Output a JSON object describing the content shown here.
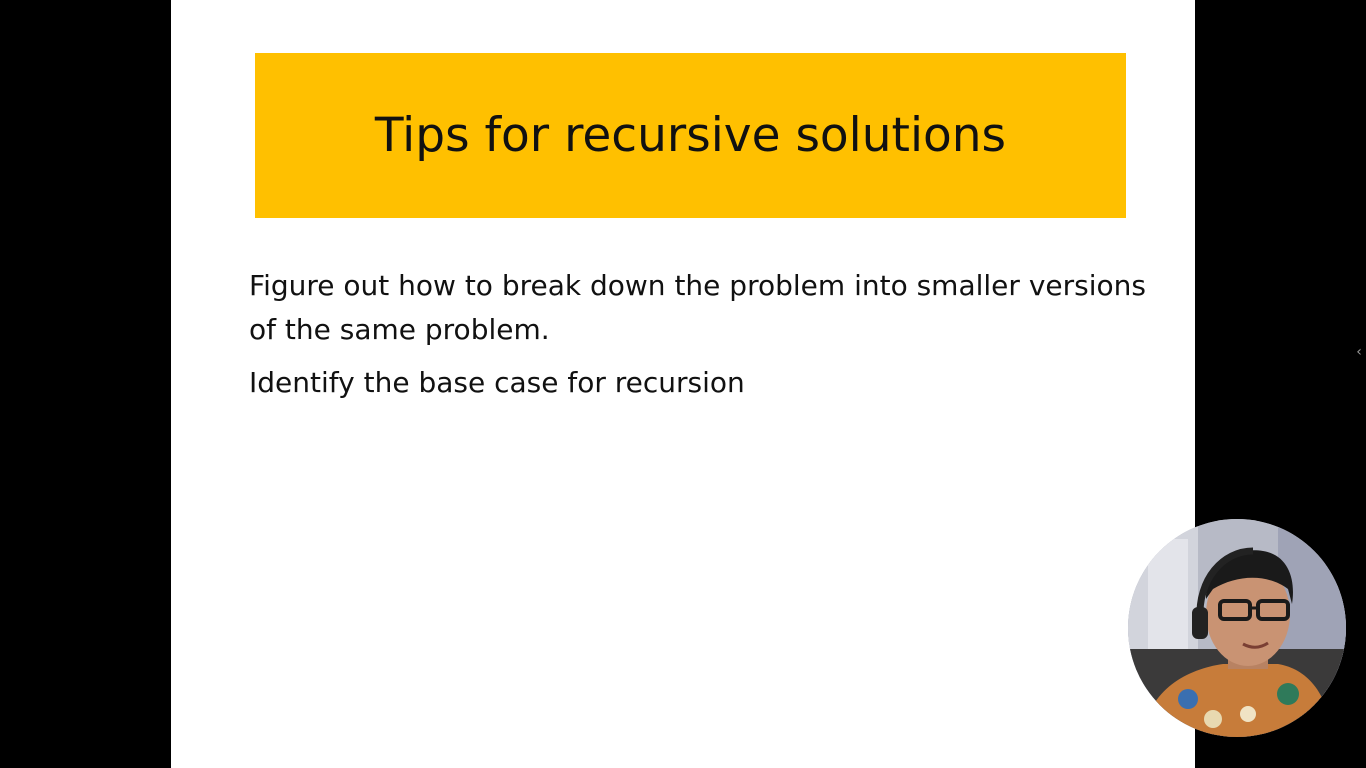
{
  "slide": {
    "title": "Tips for recursive solutions",
    "paragraphs": [
      "Figure out how to break down the problem into smaller versions of the same problem.",
      "Identify the base case for recursion"
    ]
  },
  "controls": {
    "side_toggle_icon": "chevron-left-icon",
    "side_toggle_glyph": "‹"
  },
  "webcam": {
    "icon": "presenter-webcam"
  },
  "colors": {
    "title_bar": "#FFC000",
    "background": "#000000",
    "slide": "#FFFFFF"
  }
}
